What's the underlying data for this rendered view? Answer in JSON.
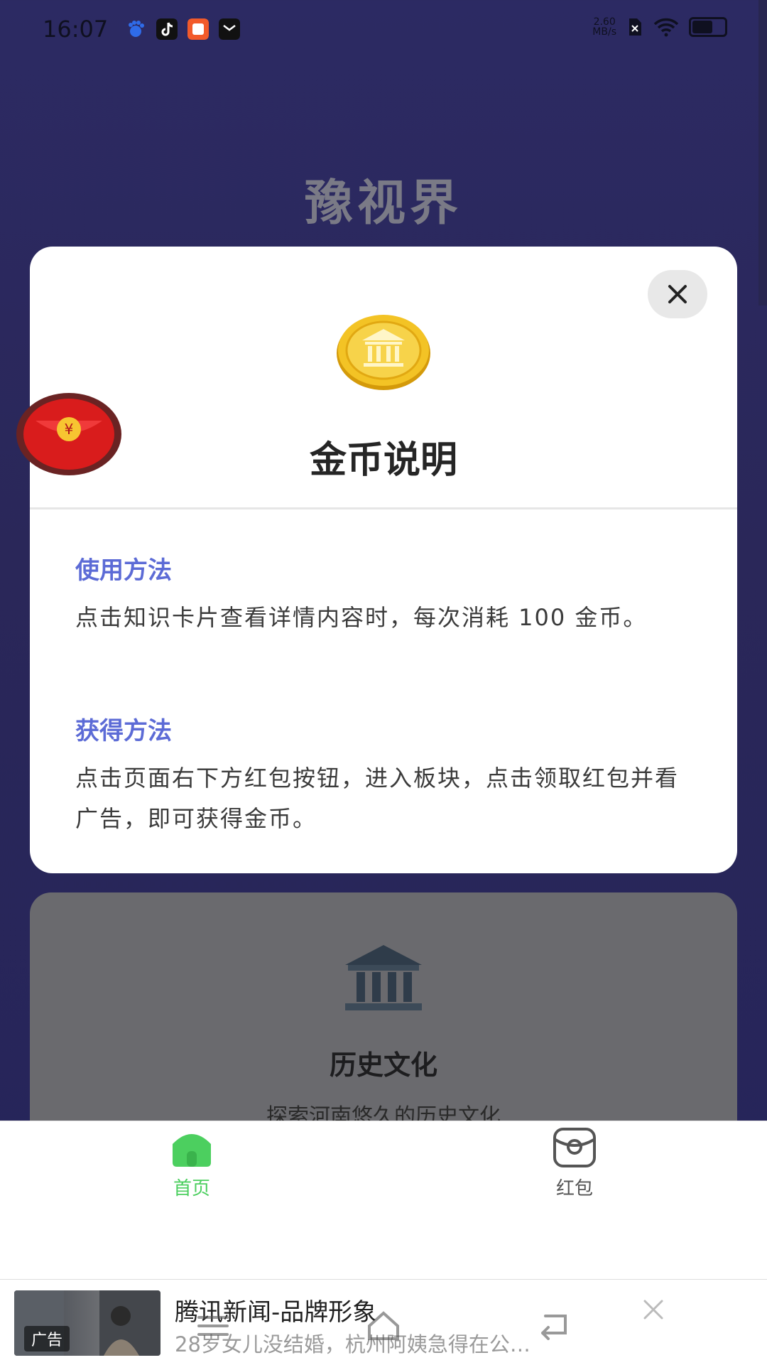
{
  "status_bar": {
    "time": "16:07",
    "net_speed_value": "2.60",
    "net_speed_unit": "MB/s",
    "icons": [
      "baidu-icon",
      "tiktok-icon",
      "app-icon",
      "mail-icon",
      "nosim-icon",
      "wifi-icon",
      "battery-icon"
    ]
  },
  "app": {
    "title": "豫视界"
  },
  "modal": {
    "title": "金币说明",
    "sections": [
      {
        "heading": "使用方法",
        "body": "点击知识卡片查看详情内容时，每次消耗 100 金币。"
      },
      {
        "heading": "获得方法",
        "body": "点击页面右下方红包按钮，进入板块，点击领取红包并看广告，即可获得金币。"
      }
    ]
  },
  "background_card": {
    "title": "历史文化",
    "subtitle": "探索河南悠久的历史文化"
  },
  "tabbar": {
    "items": [
      {
        "label": "首页",
        "active": true
      },
      {
        "label": "红包",
        "active": false
      }
    ]
  },
  "ad": {
    "tag": "广告",
    "title": "腾讯新闻-品牌形象",
    "subtitle": "28岁女儿没结婚，杭州阿姨急得在公…"
  },
  "colors": {
    "accent_blue": "#5c6bd6",
    "tab_active_green": "#4ccf5f",
    "background_top": "#2c2a63"
  }
}
